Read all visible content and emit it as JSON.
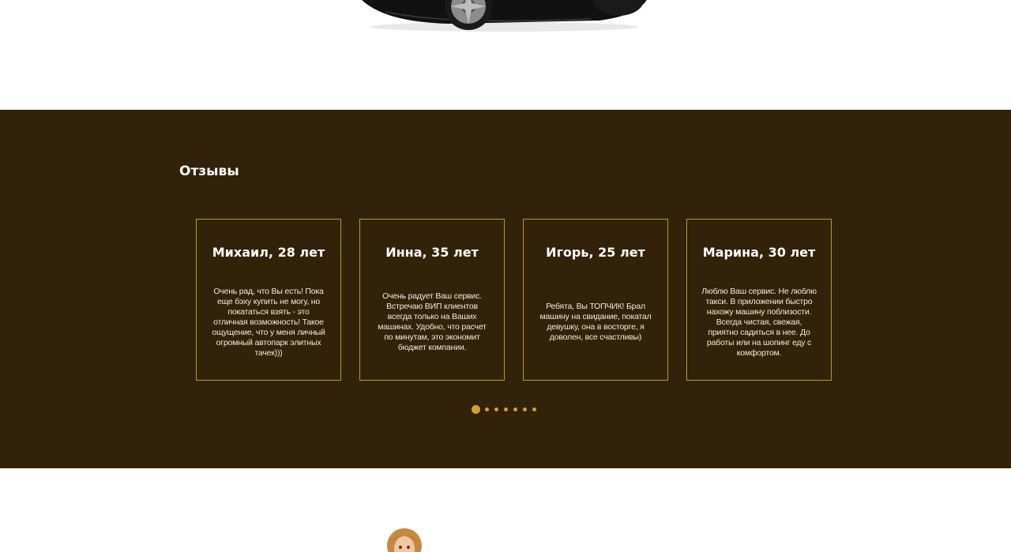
{
  "reviews": {
    "title": "Отзывы",
    "items": [
      {
        "name": "Михаил, 28 лет",
        "text": "Очень рад, что Вы есть! Пока еще бэху купить не могу, но покататься взять - это отличная возможность! Такое ощущение, что у меня личный огромный автопарк элитных тачек)))"
      },
      {
        "name": "Инна, 35 лет",
        "text": "Очень радует Ваш сервис. Встречаю ВИП клиентов всегда только на Ваших машинах. Удобно, что расчет по минутам, это экономит бюджет компании."
      },
      {
        "name": "Игорь, 25 лет",
        "text": "Ребята, Вы ТОПЧИК! Брал машину на свидание, покатал девушку, она в восторге, я доволен, все счастливы)"
      },
      {
        "name": "Марина, 30 лет",
        "text": "Люблю Ваш сервис. Не люблю такси. В приложении быстро нахожу машину поблизости. Всегда чистая, свежая, приятно садиться в нее. До работы или на шопинг еду с комфортом."
      }
    ],
    "pagination": {
      "total": 7,
      "active": 1
    }
  },
  "colors": {
    "section_bg": "#33220a",
    "accent": "#cca52a",
    "card_border": "#b59a2a"
  }
}
